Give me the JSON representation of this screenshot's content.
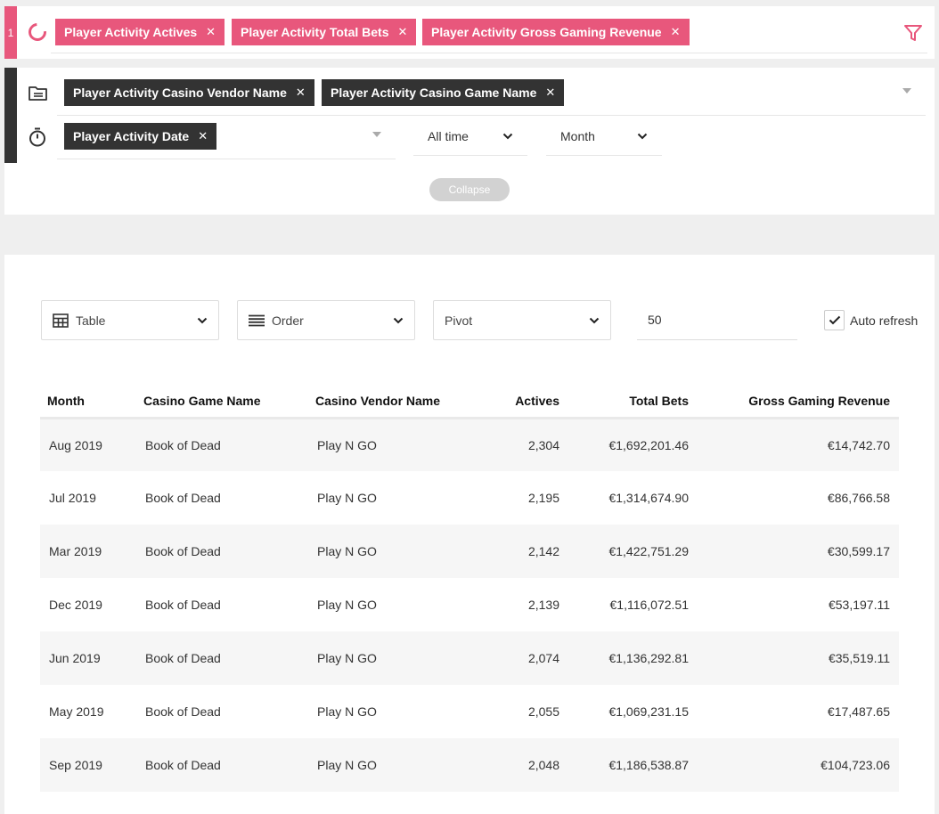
{
  "measures": {
    "index": "1",
    "chips": [
      {
        "label": "Player Activity Actives"
      },
      {
        "label": "Player Activity Total Bets"
      },
      {
        "label": "Player Activity Gross Gaming Revenue"
      }
    ]
  },
  "dimensions": {
    "chips": [
      {
        "label": "Player Activity Casino Vendor Name"
      },
      {
        "label": "Player Activity Casino Game Name"
      }
    ],
    "time_chip": {
      "label": "Player Activity Date"
    },
    "date_range": "All time",
    "granularity": "Month",
    "collapse_label": "Collapse"
  },
  "controls": {
    "view": "Table",
    "order": "Order",
    "pivot": "Pivot",
    "limit": "50",
    "auto_refresh_label": "Auto refresh",
    "auto_refresh_checked": true
  },
  "table": {
    "headers": [
      "Month",
      "Casino Game Name",
      "Casino Vendor Name",
      "Actives",
      "Total Bets",
      "Gross Gaming Revenue"
    ],
    "rows": [
      [
        "Aug 2019",
        "Book of Dead",
        "Play N GO",
        "2,304",
        "€1,692,201.46",
        "€14,742.70"
      ],
      [
        "Jul 2019",
        "Book of Dead",
        "Play N GO",
        "2,195",
        "€1,314,674.90",
        "€86,766.58"
      ],
      [
        "Mar 2019",
        "Book of Dead",
        "Play N GO",
        "2,142",
        "€1,422,751.29",
        "€30,599.17"
      ],
      [
        "Dec 2019",
        "Book of Dead",
        "Play N GO",
        "2,139",
        "€1,116,072.51",
        "€53,197.11"
      ],
      [
        "Jun 2019",
        "Book of Dead",
        "Play N GO",
        "2,074",
        "€1,136,292.81",
        "€35,519.11"
      ],
      [
        "May 2019",
        "Book of Dead",
        "Play N GO",
        "2,055",
        "€1,069,231.15",
        "€17,487.65"
      ],
      [
        "Sep 2019",
        "Book of Dead",
        "Play N GO",
        "2,048",
        "€1,186,538.87",
        "€104,723.06"
      ]
    ]
  },
  "colors": {
    "accent": "#e8577c",
    "dark_chip": "#333333"
  }
}
